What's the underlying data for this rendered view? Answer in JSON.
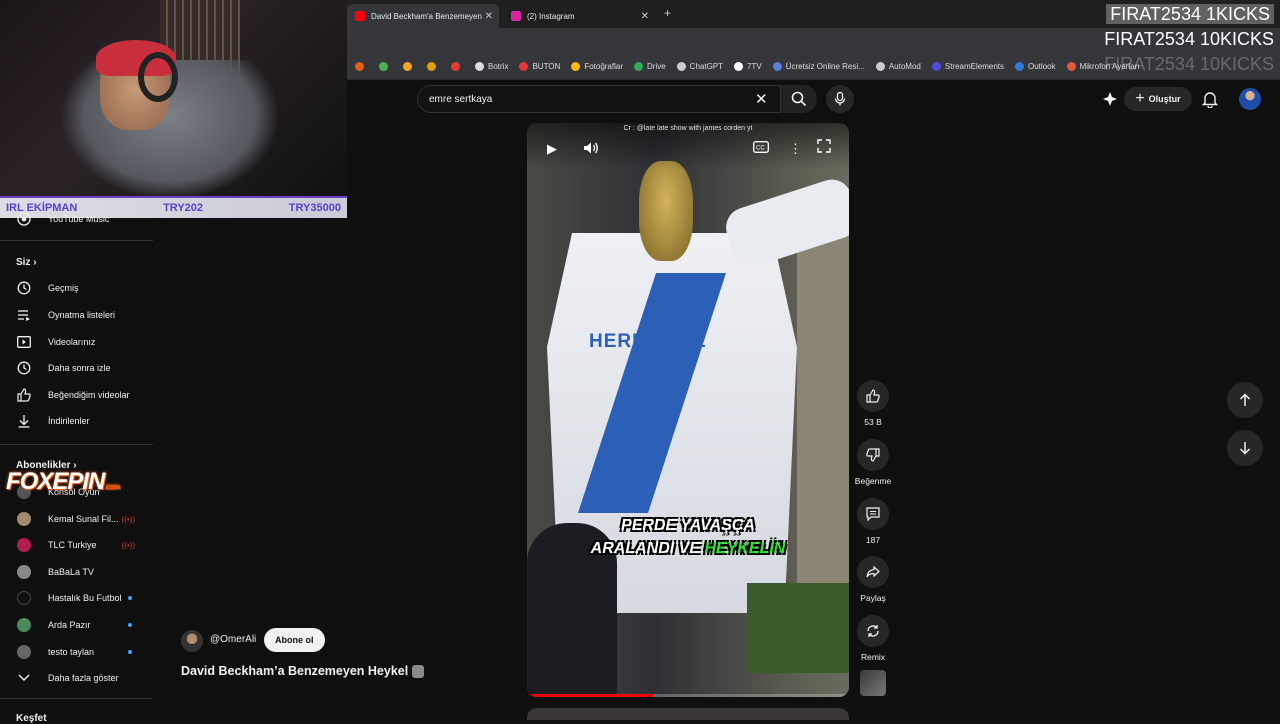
{
  "browser": {
    "tabs": [
      {
        "title": "David Beckham'a Benzemeyen",
        "favicon_color": "#ff0000"
      },
      {
        "title": "(2) Instagram",
        "favicon_color": "#d6249f"
      }
    ],
    "new_tab_label": "+",
    "bookmarks": [
      {
        "label": "Botrix",
        "color": "#dddddd"
      },
      {
        "label": "BUTON",
        "color": "#e53935"
      },
      {
        "label": "Fotoğraflar",
        "color": "#fbbc04"
      },
      {
        "label": "Drive",
        "color": "#34a853"
      },
      {
        "label": "ChatGPT",
        "color": "#cccccc"
      },
      {
        "label": "7TV",
        "color": "#ffffff"
      },
      {
        "label": "Ücretsiz Online Resi...",
        "color": "#5b7bd5"
      },
      {
        "label": "AutoMod",
        "color": "#cccccc"
      },
      {
        "label": "StreamElements",
        "color": "#4b4bd6"
      },
      {
        "label": "Outlook",
        "color": "#2f7bd6"
      },
      {
        "label": "Mikrofon Ayarları",
        "color": "#e2583e"
      }
    ]
  },
  "overlay": {
    "kick_lines": [
      "FIRAT2534  1KICKS",
      "FIRAT2534  10KICKS",
      "FIRAT2534  10KICKS"
    ],
    "irl_bar": {
      "label": "IRL EKİPMAN",
      "price1": "TRY202",
      "price2": "TRY35000"
    },
    "sponsor": {
      "name": "FOXEPIN",
      "suffix": ".com"
    }
  },
  "header": {
    "search_value": "emre sertkaya",
    "create_label": "Oluştur"
  },
  "sidebar": {
    "top_item": "YouTube Music",
    "you_heading": "Siz",
    "you_items": [
      {
        "label": "Geçmiş",
        "icon": "history-icon"
      },
      {
        "label": "Oynatma listeleri",
        "icon": "playlist-icon"
      },
      {
        "label": "Videolarınız",
        "icon": "your-videos-icon"
      },
      {
        "label": "Daha sonra izle",
        "icon": "watch-later-icon"
      },
      {
        "label": "Beğendiğim videolar",
        "icon": "liked-icon"
      },
      {
        "label": "İndirilenler",
        "icon": "download-icon"
      }
    ],
    "subs_heading": "Abonelikler",
    "subscriptions": [
      {
        "label": "Konsol Oyun",
        "color": "#555555",
        "status": "none"
      },
      {
        "label": "Kemal Sunal Fil...",
        "color": "#a08a6a",
        "status": "live"
      },
      {
        "label": "TLC Turkiye",
        "color": "#b01e4e",
        "status": "live"
      },
      {
        "label": "BaBaLa TV",
        "color": "#888888",
        "status": "none"
      },
      {
        "label": "Hastalık Bu Futbol",
        "color": "#111111",
        "status": "dot"
      },
      {
        "label": "Arda Pazır",
        "color": "#4a8a5a",
        "status": "dot"
      },
      {
        "label": "testo taylan",
        "color": "#666666",
        "status": "dot"
      }
    ],
    "show_more": "Daha fazla göster",
    "bottom_heading": "Keşfet"
  },
  "video": {
    "credit": "Cr : @late late show with james corden yt",
    "subtitle_line1": "PERDE YAVAŞÇA",
    "subtitle_line2_a": "ARALANDI VE ",
    "subtitle_line2_b": "HEYKELİN",
    "jersey_text": "HERBALIFE",
    "progress_fraction": 0.39
  },
  "actions": {
    "likes": "53 B",
    "dislike_label": "Beğenme",
    "comments": "187",
    "share_label": "Paylaş",
    "remix_label": "Remix"
  },
  "channel": {
    "handle": "@OmerAli",
    "subscribe_label": "Abone ol",
    "title": "David Beckham’a Benzemeyen Heykel"
  }
}
